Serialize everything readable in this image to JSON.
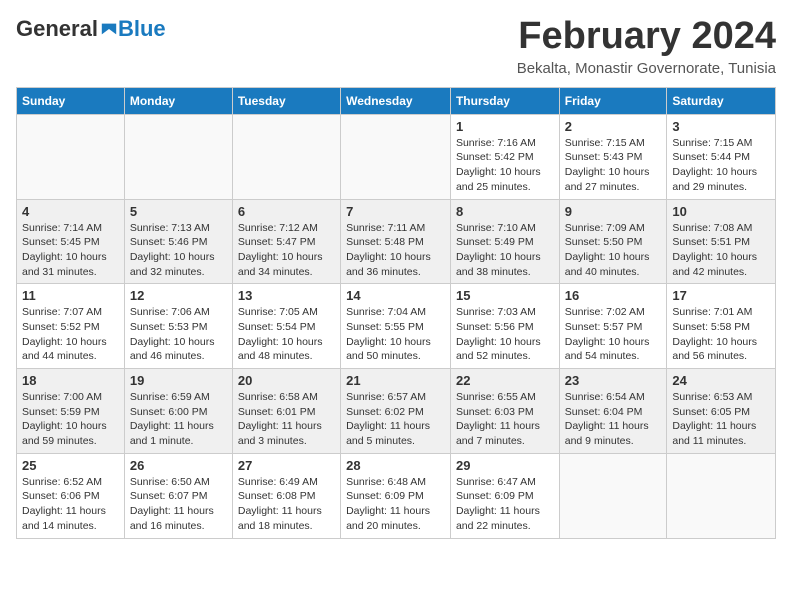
{
  "header": {
    "logo_general": "General",
    "logo_blue": "Blue",
    "month_title": "February 2024",
    "location": "Bekalta, Monastir Governorate, Tunisia"
  },
  "days_of_week": [
    "Sunday",
    "Monday",
    "Tuesday",
    "Wednesday",
    "Thursday",
    "Friday",
    "Saturday"
  ],
  "weeks": [
    {
      "shaded": false,
      "days": [
        {
          "num": "",
          "info": ""
        },
        {
          "num": "",
          "info": ""
        },
        {
          "num": "",
          "info": ""
        },
        {
          "num": "",
          "info": ""
        },
        {
          "num": "1",
          "info": "Sunrise: 7:16 AM\nSunset: 5:42 PM\nDaylight: 10 hours\nand 25 minutes."
        },
        {
          "num": "2",
          "info": "Sunrise: 7:15 AM\nSunset: 5:43 PM\nDaylight: 10 hours\nand 27 minutes."
        },
        {
          "num": "3",
          "info": "Sunrise: 7:15 AM\nSunset: 5:44 PM\nDaylight: 10 hours\nand 29 minutes."
        }
      ]
    },
    {
      "shaded": true,
      "days": [
        {
          "num": "4",
          "info": "Sunrise: 7:14 AM\nSunset: 5:45 PM\nDaylight: 10 hours\nand 31 minutes."
        },
        {
          "num": "5",
          "info": "Sunrise: 7:13 AM\nSunset: 5:46 PM\nDaylight: 10 hours\nand 32 minutes."
        },
        {
          "num": "6",
          "info": "Sunrise: 7:12 AM\nSunset: 5:47 PM\nDaylight: 10 hours\nand 34 minutes."
        },
        {
          "num": "7",
          "info": "Sunrise: 7:11 AM\nSunset: 5:48 PM\nDaylight: 10 hours\nand 36 minutes."
        },
        {
          "num": "8",
          "info": "Sunrise: 7:10 AM\nSunset: 5:49 PM\nDaylight: 10 hours\nand 38 minutes."
        },
        {
          "num": "9",
          "info": "Sunrise: 7:09 AM\nSunset: 5:50 PM\nDaylight: 10 hours\nand 40 minutes."
        },
        {
          "num": "10",
          "info": "Sunrise: 7:08 AM\nSunset: 5:51 PM\nDaylight: 10 hours\nand 42 minutes."
        }
      ]
    },
    {
      "shaded": false,
      "days": [
        {
          "num": "11",
          "info": "Sunrise: 7:07 AM\nSunset: 5:52 PM\nDaylight: 10 hours\nand 44 minutes."
        },
        {
          "num": "12",
          "info": "Sunrise: 7:06 AM\nSunset: 5:53 PM\nDaylight: 10 hours\nand 46 minutes."
        },
        {
          "num": "13",
          "info": "Sunrise: 7:05 AM\nSunset: 5:54 PM\nDaylight: 10 hours\nand 48 minutes."
        },
        {
          "num": "14",
          "info": "Sunrise: 7:04 AM\nSunset: 5:55 PM\nDaylight: 10 hours\nand 50 minutes."
        },
        {
          "num": "15",
          "info": "Sunrise: 7:03 AM\nSunset: 5:56 PM\nDaylight: 10 hours\nand 52 minutes."
        },
        {
          "num": "16",
          "info": "Sunrise: 7:02 AM\nSunset: 5:57 PM\nDaylight: 10 hours\nand 54 minutes."
        },
        {
          "num": "17",
          "info": "Sunrise: 7:01 AM\nSunset: 5:58 PM\nDaylight: 10 hours\nand 56 minutes."
        }
      ]
    },
    {
      "shaded": true,
      "days": [
        {
          "num": "18",
          "info": "Sunrise: 7:00 AM\nSunset: 5:59 PM\nDaylight: 10 hours\nand 59 minutes."
        },
        {
          "num": "19",
          "info": "Sunrise: 6:59 AM\nSunset: 6:00 PM\nDaylight: 11 hours\nand 1 minute."
        },
        {
          "num": "20",
          "info": "Sunrise: 6:58 AM\nSunset: 6:01 PM\nDaylight: 11 hours\nand 3 minutes."
        },
        {
          "num": "21",
          "info": "Sunrise: 6:57 AM\nSunset: 6:02 PM\nDaylight: 11 hours\nand 5 minutes."
        },
        {
          "num": "22",
          "info": "Sunrise: 6:55 AM\nSunset: 6:03 PM\nDaylight: 11 hours\nand 7 minutes."
        },
        {
          "num": "23",
          "info": "Sunrise: 6:54 AM\nSunset: 6:04 PM\nDaylight: 11 hours\nand 9 minutes."
        },
        {
          "num": "24",
          "info": "Sunrise: 6:53 AM\nSunset: 6:05 PM\nDaylight: 11 hours\nand 11 minutes."
        }
      ]
    },
    {
      "shaded": false,
      "days": [
        {
          "num": "25",
          "info": "Sunrise: 6:52 AM\nSunset: 6:06 PM\nDaylight: 11 hours\nand 14 minutes."
        },
        {
          "num": "26",
          "info": "Sunrise: 6:50 AM\nSunset: 6:07 PM\nDaylight: 11 hours\nand 16 minutes."
        },
        {
          "num": "27",
          "info": "Sunrise: 6:49 AM\nSunset: 6:08 PM\nDaylight: 11 hours\nand 18 minutes."
        },
        {
          "num": "28",
          "info": "Sunrise: 6:48 AM\nSunset: 6:09 PM\nDaylight: 11 hours\nand 20 minutes."
        },
        {
          "num": "29",
          "info": "Sunrise: 6:47 AM\nSunset: 6:09 PM\nDaylight: 11 hours\nand 22 minutes."
        },
        {
          "num": "",
          "info": ""
        },
        {
          "num": "",
          "info": ""
        }
      ]
    }
  ]
}
